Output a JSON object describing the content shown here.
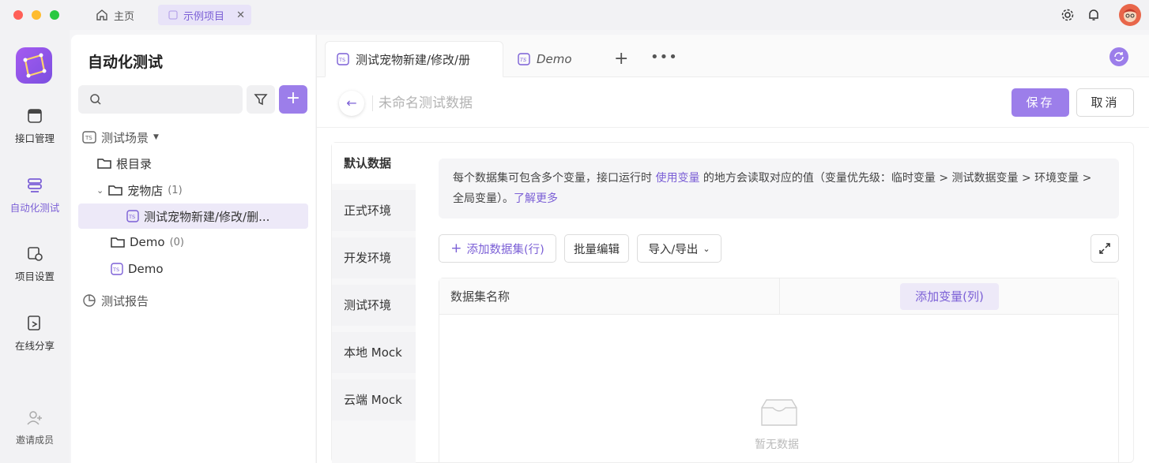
{
  "titlebar": {
    "home_label": "主页",
    "project_tab": "示例项目",
    "close_glyph": "✕"
  },
  "nav": {
    "items": [
      {
        "label": "接口管理",
        "icon": "api-icon"
      },
      {
        "label": "自动化测试",
        "icon": "automation-icon"
      },
      {
        "label": "项目设置",
        "icon": "settings-icon"
      },
      {
        "label": "在线分享",
        "icon": "share-icon"
      }
    ],
    "invite": "邀请成员"
  },
  "sidebar": {
    "title": "自动化测试",
    "tree": {
      "scenarios_label": "测试场景",
      "root": "根目录",
      "petshop": "宠物店",
      "petshop_count": "(1)",
      "scenario_item": "测试宠物新建/修改/删...",
      "demo_folder": "Demo",
      "demo_count": "(0)",
      "demo_item": "Demo",
      "reports": "测试报告"
    }
  },
  "tabs": {
    "active_label": "测试宠物新建/修改/册",
    "demo_label": "Demo",
    "plus": "+",
    "more": "•••"
  },
  "header": {
    "back": "←",
    "name_placeholder": "未命名测试数据",
    "save_label": "保存",
    "cancel_label": "取消"
  },
  "env": {
    "items": [
      "默认数据",
      "正式环境",
      "开发环境",
      "测试环境",
      "本地 Mock",
      "云端 Mock"
    ]
  },
  "info": {
    "part1": "每个数据集可包含多个变量，接口运行时 ",
    "link1": "使用变量",
    "part2": " 的地方会读取对应的值（变量优先级：临时变量 > 测试数据变量 > 环境变量 > 全局变量）。",
    "link2": "了解更多"
  },
  "toolbar": {
    "add_dataset": "添加数据集(行)",
    "batch_edit": "批量编辑",
    "import_export": "导入/导出"
  },
  "table": {
    "col_name": "数据集名称",
    "add_var": "添加变量(列)",
    "empty": "暂无数据"
  },
  "colors": {
    "accent": "#9c7eea",
    "accent_text": "#7b5fd6"
  }
}
